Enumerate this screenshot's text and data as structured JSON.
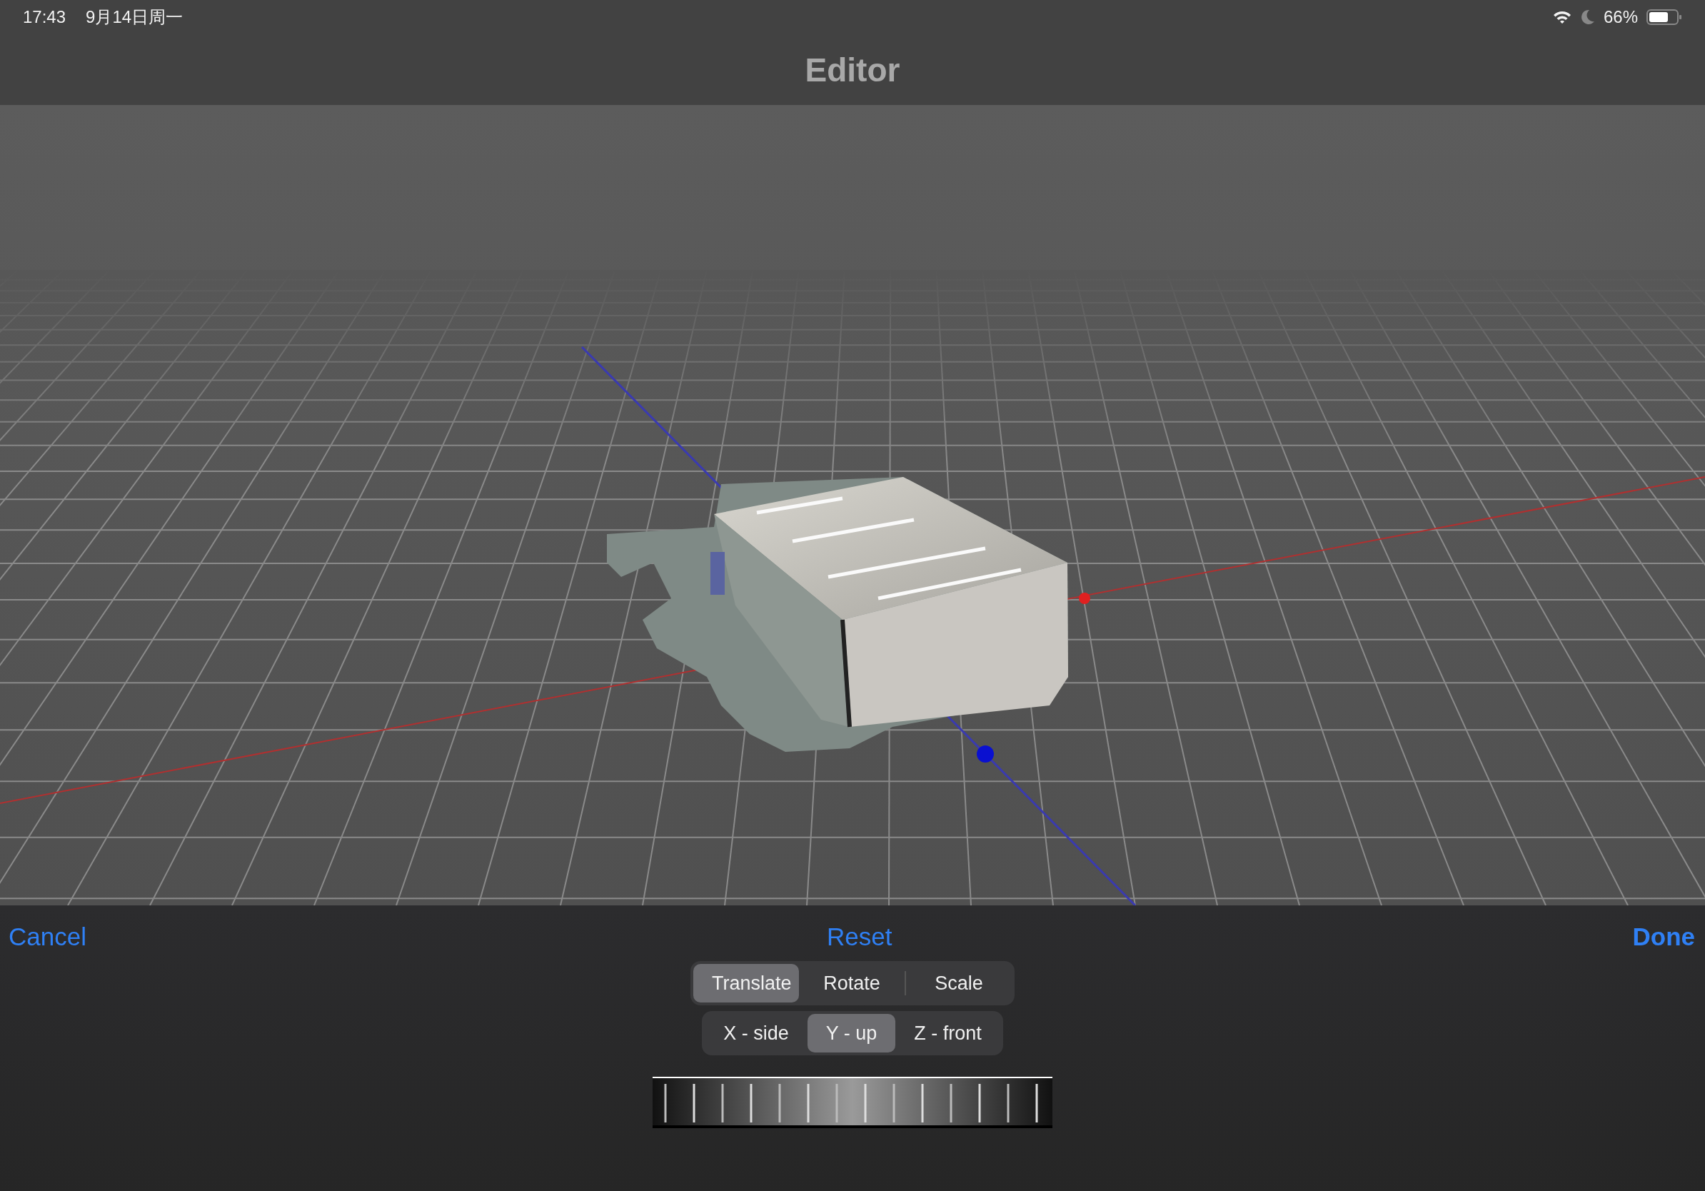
{
  "status_bar": {
    "time": "17:43",
    "date": "9月14日周一",
    "battery": "66%"
  },
  "nav_bar": {
    "title": "Editor"
  },
  "actions": {
    "cancel": "Cancel",
    "reset": "Reset",
    "done": "Done"
  },
  "modes": [
    {
      "label": "Translate",
      "selected": true
    },
    {
      "label": "Rotate",
      "selected": false
    },
    {
      "label": "Scale",
      "selected": false
    }
  ],
  "axes": [
    {
      "label": "X - side",
      "selected": false
    },
    {
      "label": "Y - up",
      "selected": true
    },
    {
      "label": "Z - front",
      "selected": false
    }
  ]
}
